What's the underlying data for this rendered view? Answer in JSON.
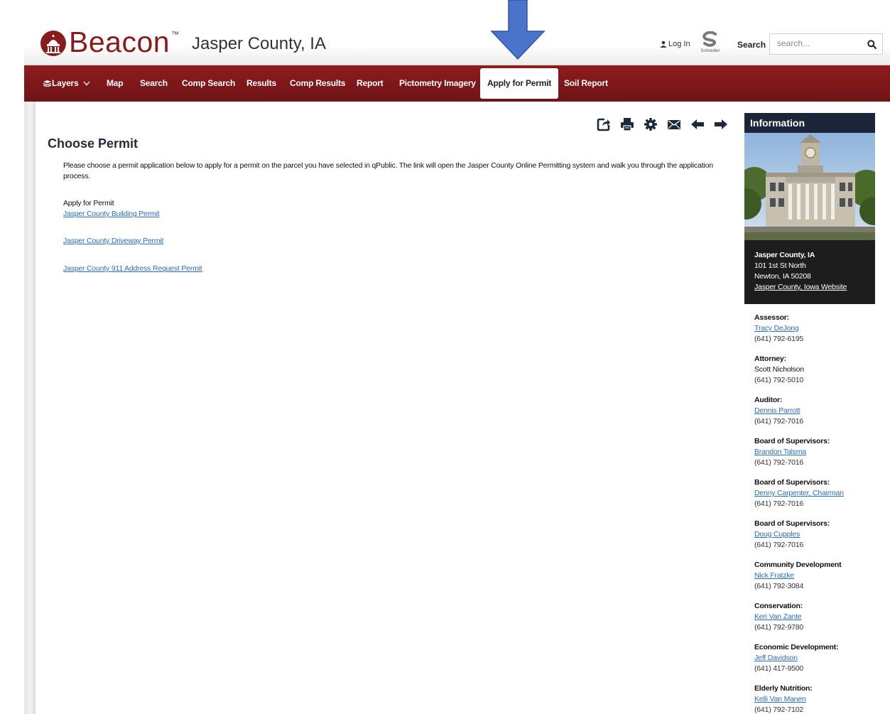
{
  "header": {
    "logo_text": "Beacon",
    "logo_tm": "™",
    "county_title": "Jasper County, IA",
    "login_label": "Log In",
    "vendor_logo_text": "Schneider",
    "search_label": "Search",
    "search_placeholder": "search..."
  },
  "nav": {
    "items": [
      {
        "label": "Layers"
      },
      {
        "label": "Map"
      },
      {
        "label": "Search"
      },
      {
        "label": "Comp Search"
      },
      {
        "label": "Results"
      },
      {
        "label": "Comp Results"
      },
      {
        "label": "Report"
      },
      {
        "label": "Pictometry Imagery"
      },
      {
        "label": "Apply for Permit"
      },
      {
        "label": "Soil Report"
      }
    ],
    "active_index": 8
  },
  "toolbar": {
    "icons": [
      "share-icon",
      "print-icon",
      "settings-icon",
      "email-icon",
      "back-arrow-icon",
      "forward-arrow-icon"
    ]
  },
  "main": {
    "title": "Choose Permit",
    "intro": "Please choose a permit application below to apply for a permit on the parcel you have selected in qPublic. The link will open the Jasper County Online Permitting system and walk you through the application process.",
    "apply_label": "Apply for Permit",
    "permits": [
      {
        "label": "Jasper County Building Permit"
      },
      {
        "label": "Jasper County Driveway Permit"
      },
      {
        "label": "Jasper County 911 Address Request Permit"
      }
    ]
  },
  "info": {
    "header": "Information",
    "address": {
      "name": "Jasper County, IA",
      "line1": "101 1st St North",
      "line2": "Newton, IA 50208",
      "website": "Jasper County, Iowa Website"
    },
    "contacts": [
      {
        "role": "Assessor:",
        "person": "Tracy DeJong",
        "phone": "(641) 792-6195",
        "link": true
      },
      {
        "role": "Attorney:",
        "person": "Scott Nicholson",
        "phone": "(641) 792-5010",
        "link": false
      },
      {
        "role": "Auditor:",
        "person": "Dennis Parrott",
        "phone": "(641) 792-7016",
        "link": true
      },
      {
        "role": "Board of Supervisors:",
        "person": "Brandon Talsma",
        "phone": "(641) 792-7016",
        "link": true
      },
      {
        "role": "Board of Supervisors:",
        "person": "Denny Carpenter, Chairman",
        "phone": "(641) 792-7016",
        "link": true
      },
      {
        "role": "Board of Supervisors:",
        "person": "Doug Cupples",
        "phone": "(641) 792-7016",
        "link": true
      },
      {
        "role": "Community Development",
        "person": "Nick Fratzke",
        "phone": "(641) 792-3084",
        "link": true
      },
      {
        "role": "Conservation:",
        "person": "Keri Van Zante",
        "phone": "(641) 792-9780",
        "link": true
      },
      {
        "role": "Economic Development:",
        "person": "Jeff Davidson",
        "phone": "(641) 417-9500",
        "link": true
      },
      {
        "role": "Elderly Nutrition:",
        "person": "Kelli Van Manen",
        "phone": "(641) 792-7102",
        "link": true
      }
    ]
  },
  "colors": {
    "brand": "#8a1b1b",
    "nav_bg": "#7d181a",
    "link": "#2a6ec0",
    "info_header": "#1b2438",
    "annotation_arrow": "#4a74c9"
  }
}
